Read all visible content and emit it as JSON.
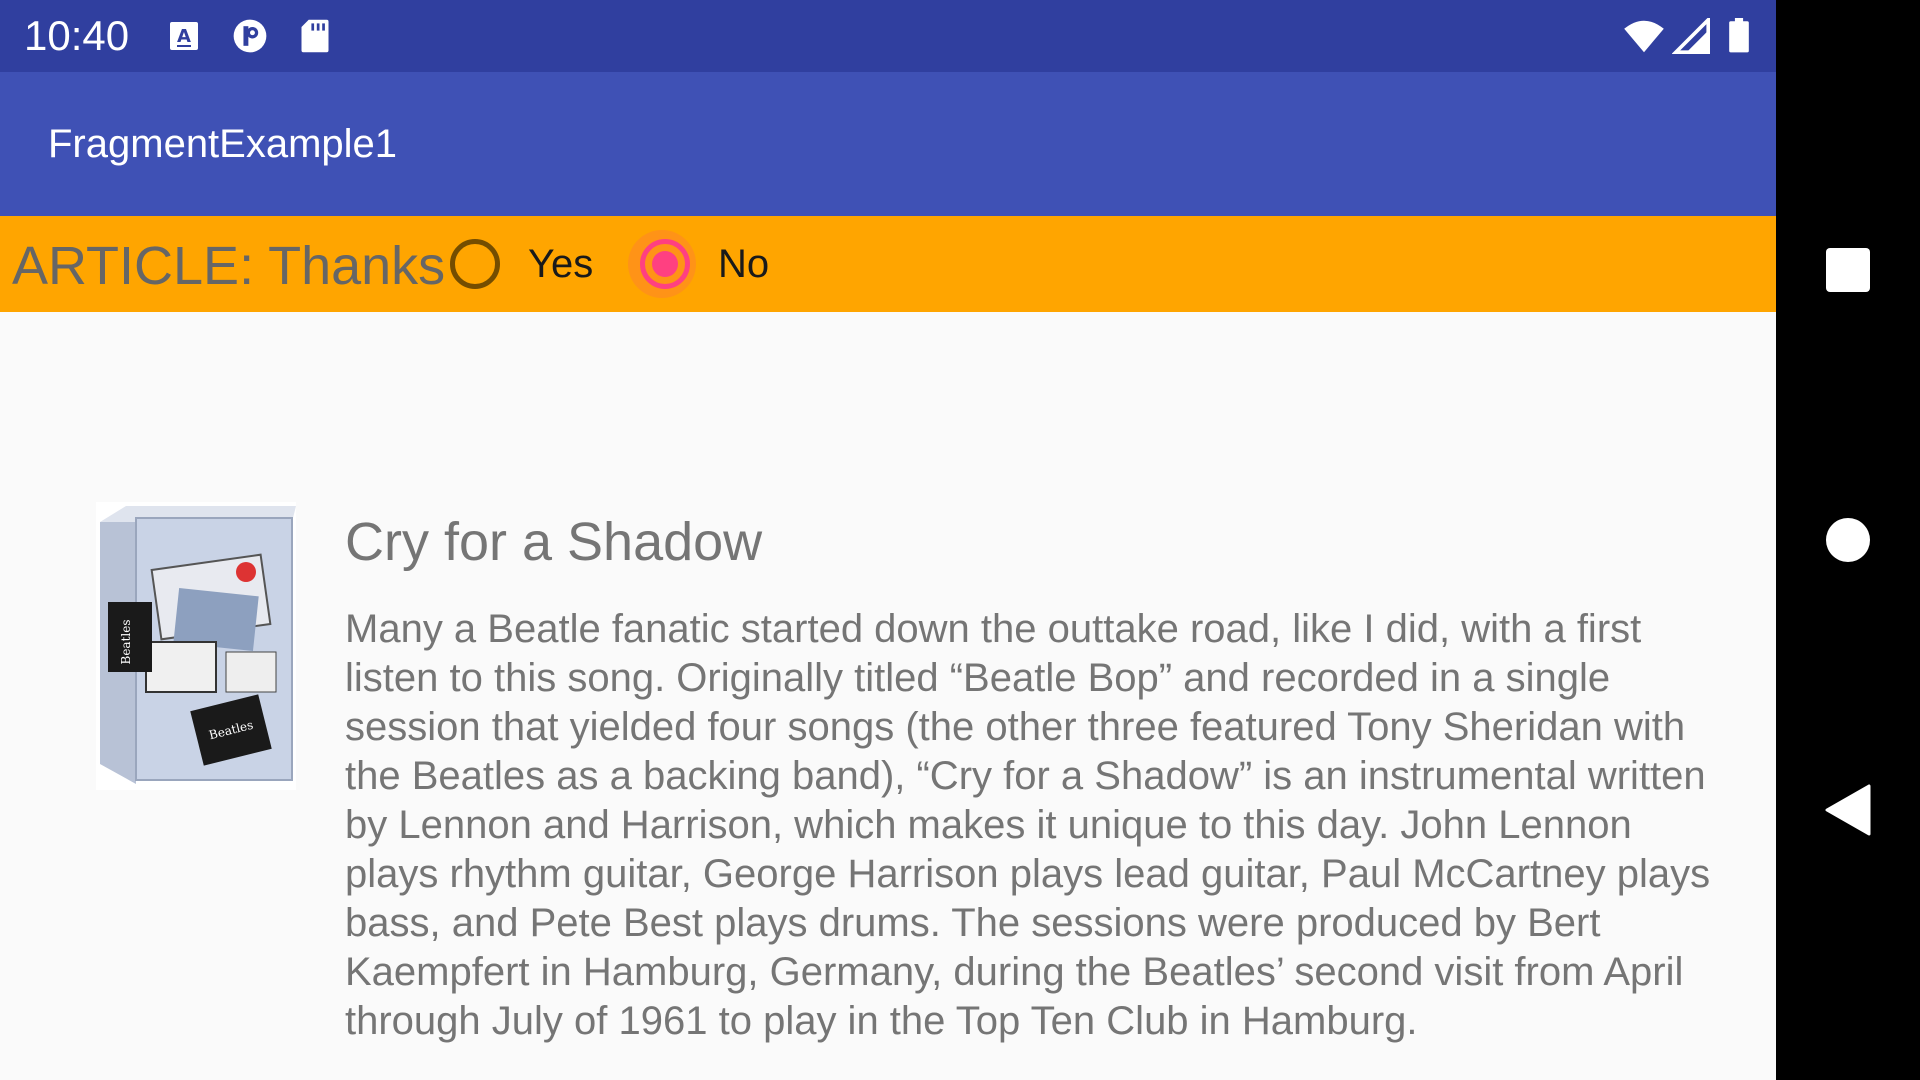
{
  "status_bar": {
    "time": "10:40",
    "icons": [
      "keyboard-a-icon",
      "app-notification-icon",
      "sd-card-icon",
      "wifi-icon",
      "cell-signal-icon",
      "battery-icon"
    ]
  },
  "app_bar": {
    "title": "FragmentExample1"
  },
  "header": {
    "article_label": "ARTICLE: Thanks",
    "radio_options": [
      {
        "label": "Yes",
        "checked": false
      },
      {
        "label": "No",
        "checked": true
      }
    ]
  },
  "article": {
    "title": "Cry for a Shadow",
    "body": "Many a Beatle fanatic started down the outtake road, like I did, with a first listen to this song. Originally titled “Beatle Bop” and recorded in a single session that yielded four songs (the other three featured Tony Sheridan with the Beatles as a backing band), “Cry for a Shadow” is an instrumental written by Lennon and Harrison, which makes it unique to this day. John Lennon plays rhythm guitar, George Harrison plays lead guitar, Paul McCartney plays bass, and Pete Best plays drums. The sessions were produced by Bert Kaempfert in Hamburg, Germany, during the Beatles’ second visit from April through July of 1961 to play in the Top Ten Club in Hamburg."
  },
  "nav_bar": {
    "buttons": [
      "recents-square-icon",
      "home-circle-icon",
      "back-triangle-icon"
    ]
  },
  "colors": {
    "status_bar": "#303f9f",
    "app_bar": "#3f51b5",
    "header": "#ffa500",
    "accent": "#ff4081"
  }
}
